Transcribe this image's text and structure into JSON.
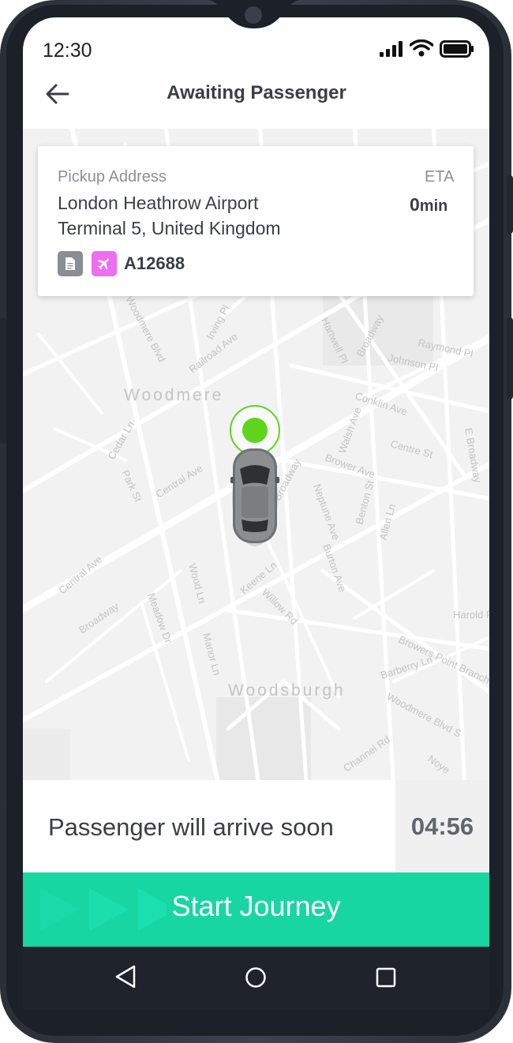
{
  "status_bar": {
    "time": "12:30"
  },
  "header": {
    "title": "Awaiting Passenger"
  },
  "pickup": {
    "label": "Pickup Address",
    "address_line1": "London Heathrow Airport",
    "address_line2": "Terminal 5, United Kingdom",
    "eta_label": "ETA",
    "eta_value": "0",
    "eta_unit": "min",
    "flight_number": "A12688"
  },
  "map": {
    "labels": {
      "woodmere": "Woodmere",
      "woodsburgh": "Woodsburgh",
      "broadway_1": "Broadway",
      "broadway_2": "Broadway",
      "broadway_3": "Broadway",
      "central_ave_1": "Central Ave",
      "central_ave_2": "Central Ave",
      "woodmere_blvd": "Woodmere Blvd",
      "raymond_pl": "Raymond Pl",
      "johnson_pl": "Johnson Pl",
      "conklin_ave": "Conklin Ave",
      "centre_st": "Centre St",
      "brower_ave": "Brower Ave",
      "railroad_ave": "Railroad Ave",
      "cedar_ln": "Cedar Ln",
      "irving_pl": "Irving Pl",
      "hartwell_pl": "Hartwell Pl",
      "walsh_ave": "Walsh Ave",
      "neptune_ave": "Neptune Ave",
      "benton_st": "Benton St",
      "allen_ln": "Allen Ln",
      "burton_ave": "Burton Ave",
      "keene_ln": "Keene Ln",
      "willow_rd": "Willow Rd",
      "wood_ln": "Wood Ln",
      "meadow_dr": "Meadow Dr",
      "manor_ln": "Manor Ln",
      "park_st": "Park St",
      "browers_point": "Browers Point Branch",
      "barberry_ln": "Barberry Ln",
      "woodmere_blvd_s": "Woodmere Blvd S",
      "harold": "Harold R",
      "channel_rd": "Channel Rd",
      "e_broadway": "E Broadway",
      "noye": "Noye"
    }
  },
  "bottom": {
    "status_message": "Passenger will arrive soon",
    "timer": "04:56",
    "start_button": "Start Journey"
  },
  "colors": {
    "accent": "#18d6a2",
    "marker": "#5fd41c",
    "flight_badge": "#ef6df0",
    "doc_badge": "#8a8d93"
  }
}
